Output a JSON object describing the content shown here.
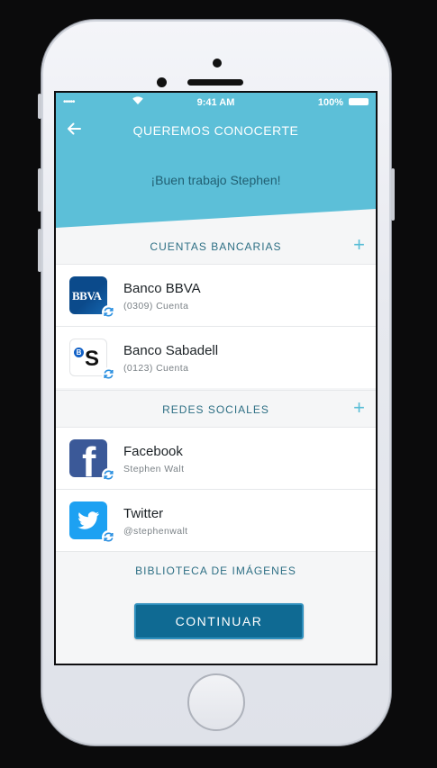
{
  "status": {
    "signal": "•••••",
    "time": "9:41 AM",
    "battery": "100%"
  },
  "nav": {
    "title": "QUEREMOS CONOCERTE",
    "back_icon": "arrow-left-icon"
  },
  "banner": {
    "message": "¡Buen trabajo Stephen!"
  },
  "sections": {
    "bank": {
      "label": "CUENTAS BANCARIAS",
      "add": "+"
    },
    "social": {
      "label": "REDES SOCIALES",
      "add": "+"
    },
    "images": {
      "label": "BIBLIOTECA DE IMÁGENES"
    }
  },
  "accounts": [
    {
      "name": "Banco BBVA",
      "detail": "(0309) Cuenta",
      "logo_text": "BBVA",
      "icon": "bbva-logo-icon"
    },
    {
      "name": "Banco Sabadell",
      "detail": "(0123) Cuenta",
      "logo_text": "S",
      "icon": "sabadell-logo-icon"
    }
  ],
  "social": [
    {
      "name": "Facebook",
      "detail": "Stephen Walt",
      "logo_text": "f",
      "icon": "facebook-logo-icon"
    },
    {
      "name": "Twitter",
      "detail": "@stephenwalt",
      "icon": "twitter-logo-icon"
    }
  ],
  "button": {
    "label": "CONTINUAR"
  },
  "colors": {
    "header": "#5cbfd8",
    "accent": "#59bdd6",
    "button": "#0f6a93",
    "section_text": "#2d6f84",
    "bbva": "#0b4a8b",
    "facebook": "#3b5998",
    "twitter": "#1da1f2"
  }
}
